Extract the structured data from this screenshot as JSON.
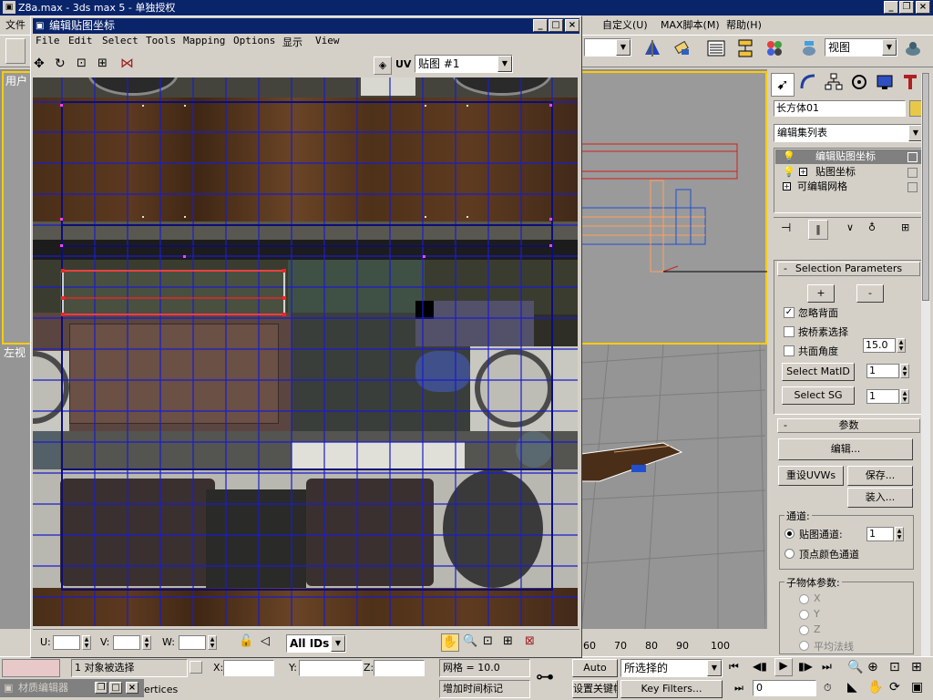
{
  "app": {
    "title": "Z8a.max - 3ds max 5 - 单独授权",
    "menu": [
      "文件",
      "自定义(U)",
      "MAX脚本(M)",
      "帮助(H)"
    ],
    "view_combo": "视图"
  },
  "viewports": {
    "top_left_label": "用户",
    "bottom_left_label": "左视",
    "ruler": [
      "60",
      "70",
      "80",
      "90",
      "100"
    ]
  },
  "uv_editor": {
    "title": "编辑贴图坐标",
    "menu": [
      "File",
      "Edit",
      "Select",
      "Tools",
      "Mapping",
      "Options",
      "显示",
      "View"
    ],
    "uv_label": "UV",
    "map_combo": "贴图 #1",
    "u_label": "U:",
    "v_label": "V:",
    "w_label": "W:",
    "ids_combo": "All IDs"
  },
  "command_panel": {
    "object_name": "长方体01",
    "object_color": "#e8c84a",
    "modifier_list": "编辑集列表",
    "stack": [
      "编辑贴图坐标",
      "贴图坐标",
      "可编辑网格"
    ],
    "selection_params": {
      "title": "Selection Parameters",
      "plus": "+",
      "minus": "-",
      "ignore_backface": "忽略背面",
      "select_by_element": "按桥素选择",
      "planar_angle": "共面角度",
      "planar_angle_value": "15.0",
      "select_matid": "Select MatID",
      "matid_value": "1",
      "select_sg": "Select SG",
      "sg_value": "1"
    },
    "params": {
      "title": "参数",
      "edit": "编辑...",
      "reset_uvws": "重设UVWs",
      "save": "保存...",
      "load": "装入...",
      "channel_group": "通道:",
      "map_channel": "贴图通道:",
      "map_channel_value": "1",
      "vertex_color": "顶点颜色通道",
      "sub_params": "子物体参数:",
      "axes": [
        "X",
        "Y",
        "Z"
      ],
      "align": "平均法线"
    }
  },
  "status": {
    "selected": "1 对象被选择",
    "x_label": "X:",
    "y_label": "Y:",
    "z_label": "Z:",
    "grid": "网格 = 10.0",
    "add_time_tag": "增加时间标记",
    "auto_key": "Auto Key",
    "selected_combo": "所选择的",
    "set_key": "设置关键帧",
    "key_filters": "Key Filters...",
    "frame": "0",
    "material_editor": "材质编辑器",
    "vertices": "ertices"
  },
  "accent": {
    "title_blue": "#0a246a",
    "grid_blue": "#1c1ccc",
    "selection_red": "#ff2020",
    "active_yellow": "#ffcc00"
  }
}
